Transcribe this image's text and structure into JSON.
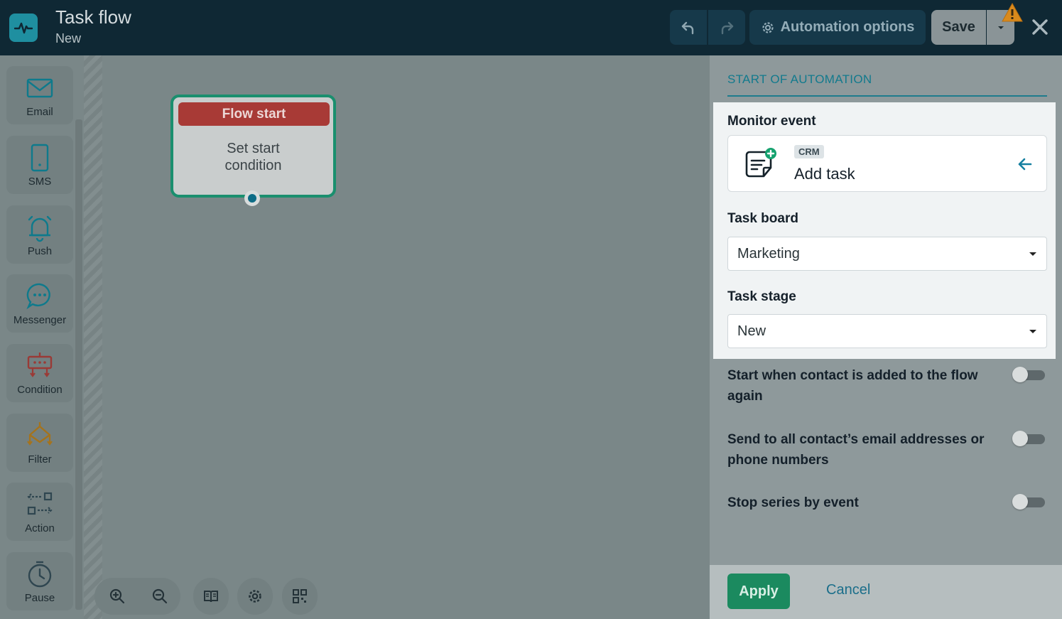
{
  "header": {
    "title": "Task flow",
    "subtitle": "New",
    "automation_options_label": "Automation options",
    "save_label": "Save"
  },
  "palette": {
    "items": [
      {
        "label": "Email",
        "icon": "email-icon"
      },
      {
        "label": "SMS",
        "icon": "sms-icon"
      },
      {
        "label": "Push",
        "icon": "push-icon"
      },
      {
        "label": "Messenger",
        "icon": "messenger-icon"
      },
      {
        "label": "Condition",
        "icon": "condition-icon"
      },
      {
        "label": "Filter",
        "icon": "filter-icon"
      },
      {
        "label": "Action",
        "icon": "action-icon"
      },
      {
        "label": "Pause",
        "icon": "pause-icon"
      }
    ]
  },
  "canvas": {
    "node": {
      "title": "Flow start",
      "body_line1": "Set start",
      "body_line2": "condition"
    }
  },
  "panel": {
    "section_title": "START OF AUTOMATION",
    "monitor_event_label": "Monitor event",
    "event": {
      "badge": "CRM",
      "name": "Add task"
    },
    "task_board_label": "Task board",
    "task_board_value": "Marketing",
    "task_stage_label": "Task stage",
    "task_stage_value": "New",
    "options": [
      {
        "text": "Start when contact is added to the flow again",
        "enabled": false
      },
      {
        "text": "Send to all contact’s email addresses or phone numbers",
        "enabled": false
      },
      {
        "text": "Stop series by event",
        "enabled": false
      }
    ],
    "apply_label": "Apply",
    "cancel_label": "Cancel"
  },
  "colors": {
    "header_bg": "#0f2834",
    "accent_teal": "#127a8d",
    "node_border": "#1a8f6e",
    "node_header": "#a83a36",
    "apply_green": "#1b8a5f",
    "warning": "#d98a1c"
  }
}
